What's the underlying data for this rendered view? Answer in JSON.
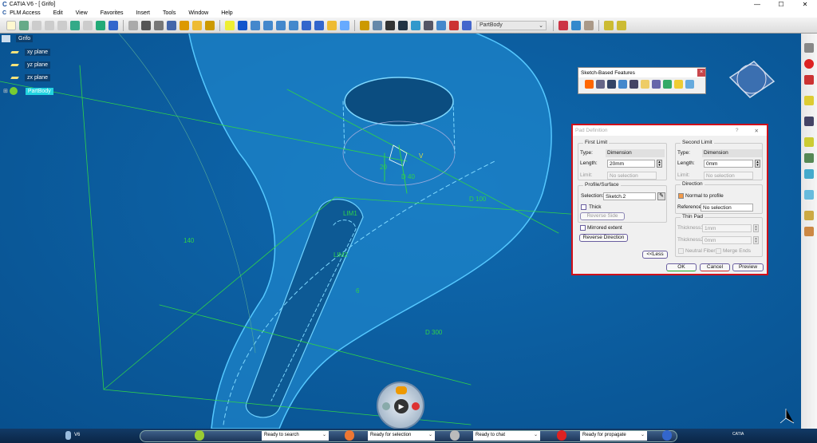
{
  "window": {
    "title": "CATIA V6 - [ Grifo]",
    "controls": [
      "—",
      "☐",
      "✕"
    ]
  },
  "menu": {
    "items": [
      "PLM Access",
      "Edit",
      "View",
      "Favorites",
      "Insert",
      "Tools",
      "Window",
      "Help"
    ]
  },
  "toolbar": {
    "current_body": "PartBody"
  },
  "tree": {
    "root": "Grifo",
    "items": [
      "xy plane",
      "yz plane",
      "zx plane",
      "PartBody"
    ]
  },
  "model_labels": {
    "l140": "140",
    "l20": "20",
    "d40": "D 40",
    "d100": "D 100",
    "d300": "D 300",
    "lim1": "LIM1",
    "lim2": "LIM2",
    "l6": "6",
    "v": "V"
  },
  "sketch_toolbar": {
    "title": "Sketch-Based Features",
    "close": "×"
  },
  "pad_dialog": {
    "title": "Pad Definition",
    "help": "?",
    "close": "✕",
    "first_limit": {
      "title": "First Limit",
      "type_label": "Type:",
      "type_value": "Dimension",
      "length_label": "Length:",
      "length_value": "20mm",
      "limit_label": "Limit:",
      "limit_value": "No selection"
    },
    "profile": {
      "title": "Profile/Surface",
      "selection_label": "Selection:",
      "selection_value": "Sketch.2",
      "thick": "Thick",
      "reverse_side": "Reverse Side"
    },
    "mirrored": "Mirrored extent",
    "reverse_direction": "Reverse Direction",
    "less": "<<Less",
    "second_limit": {
      "title": "Second Limit",
      "type_label": "Type:",
      "type_value": "Dimension",
      "length_label": "Length:",
      "length_value": "0mm",
      "limit_label": "Limit:",
      "limit_value": "No selection"
    },
    "direction": {
      "title": "Direction",
      "normal": "Normal to profile",
      "reference_label": "Reference:",
      "reference_value": "No selection"
    },
    "thin_pad": {
      "title": "Thin Pad",
      "t1_label": "Thickness1:",
      "t1_value": "1mm",
      "t2_label": "Thickness2:",
      "t2_value": "0mm",
      "neutral": "Neutral Fiber",
      "merge": "Merge Ends"
    },
    "ok": "OK",
    "cancel": "Cancel",
    "preview": "Preview"
  },
  "status": {
    "v6": "V6",
    "search": "Ready to search",
    "selection": "Ready for selection",
    "chat": "Ready to chat",
    "propagate": "Ready for propagate",
    "brand": "CATIA"
  },
  "colors": {
    "viewport": "#0a5c9c",
    "model": "#36b6f0",
    "dims": "#2fd24a",
    "highlight": "#d0101a"
  }
}
